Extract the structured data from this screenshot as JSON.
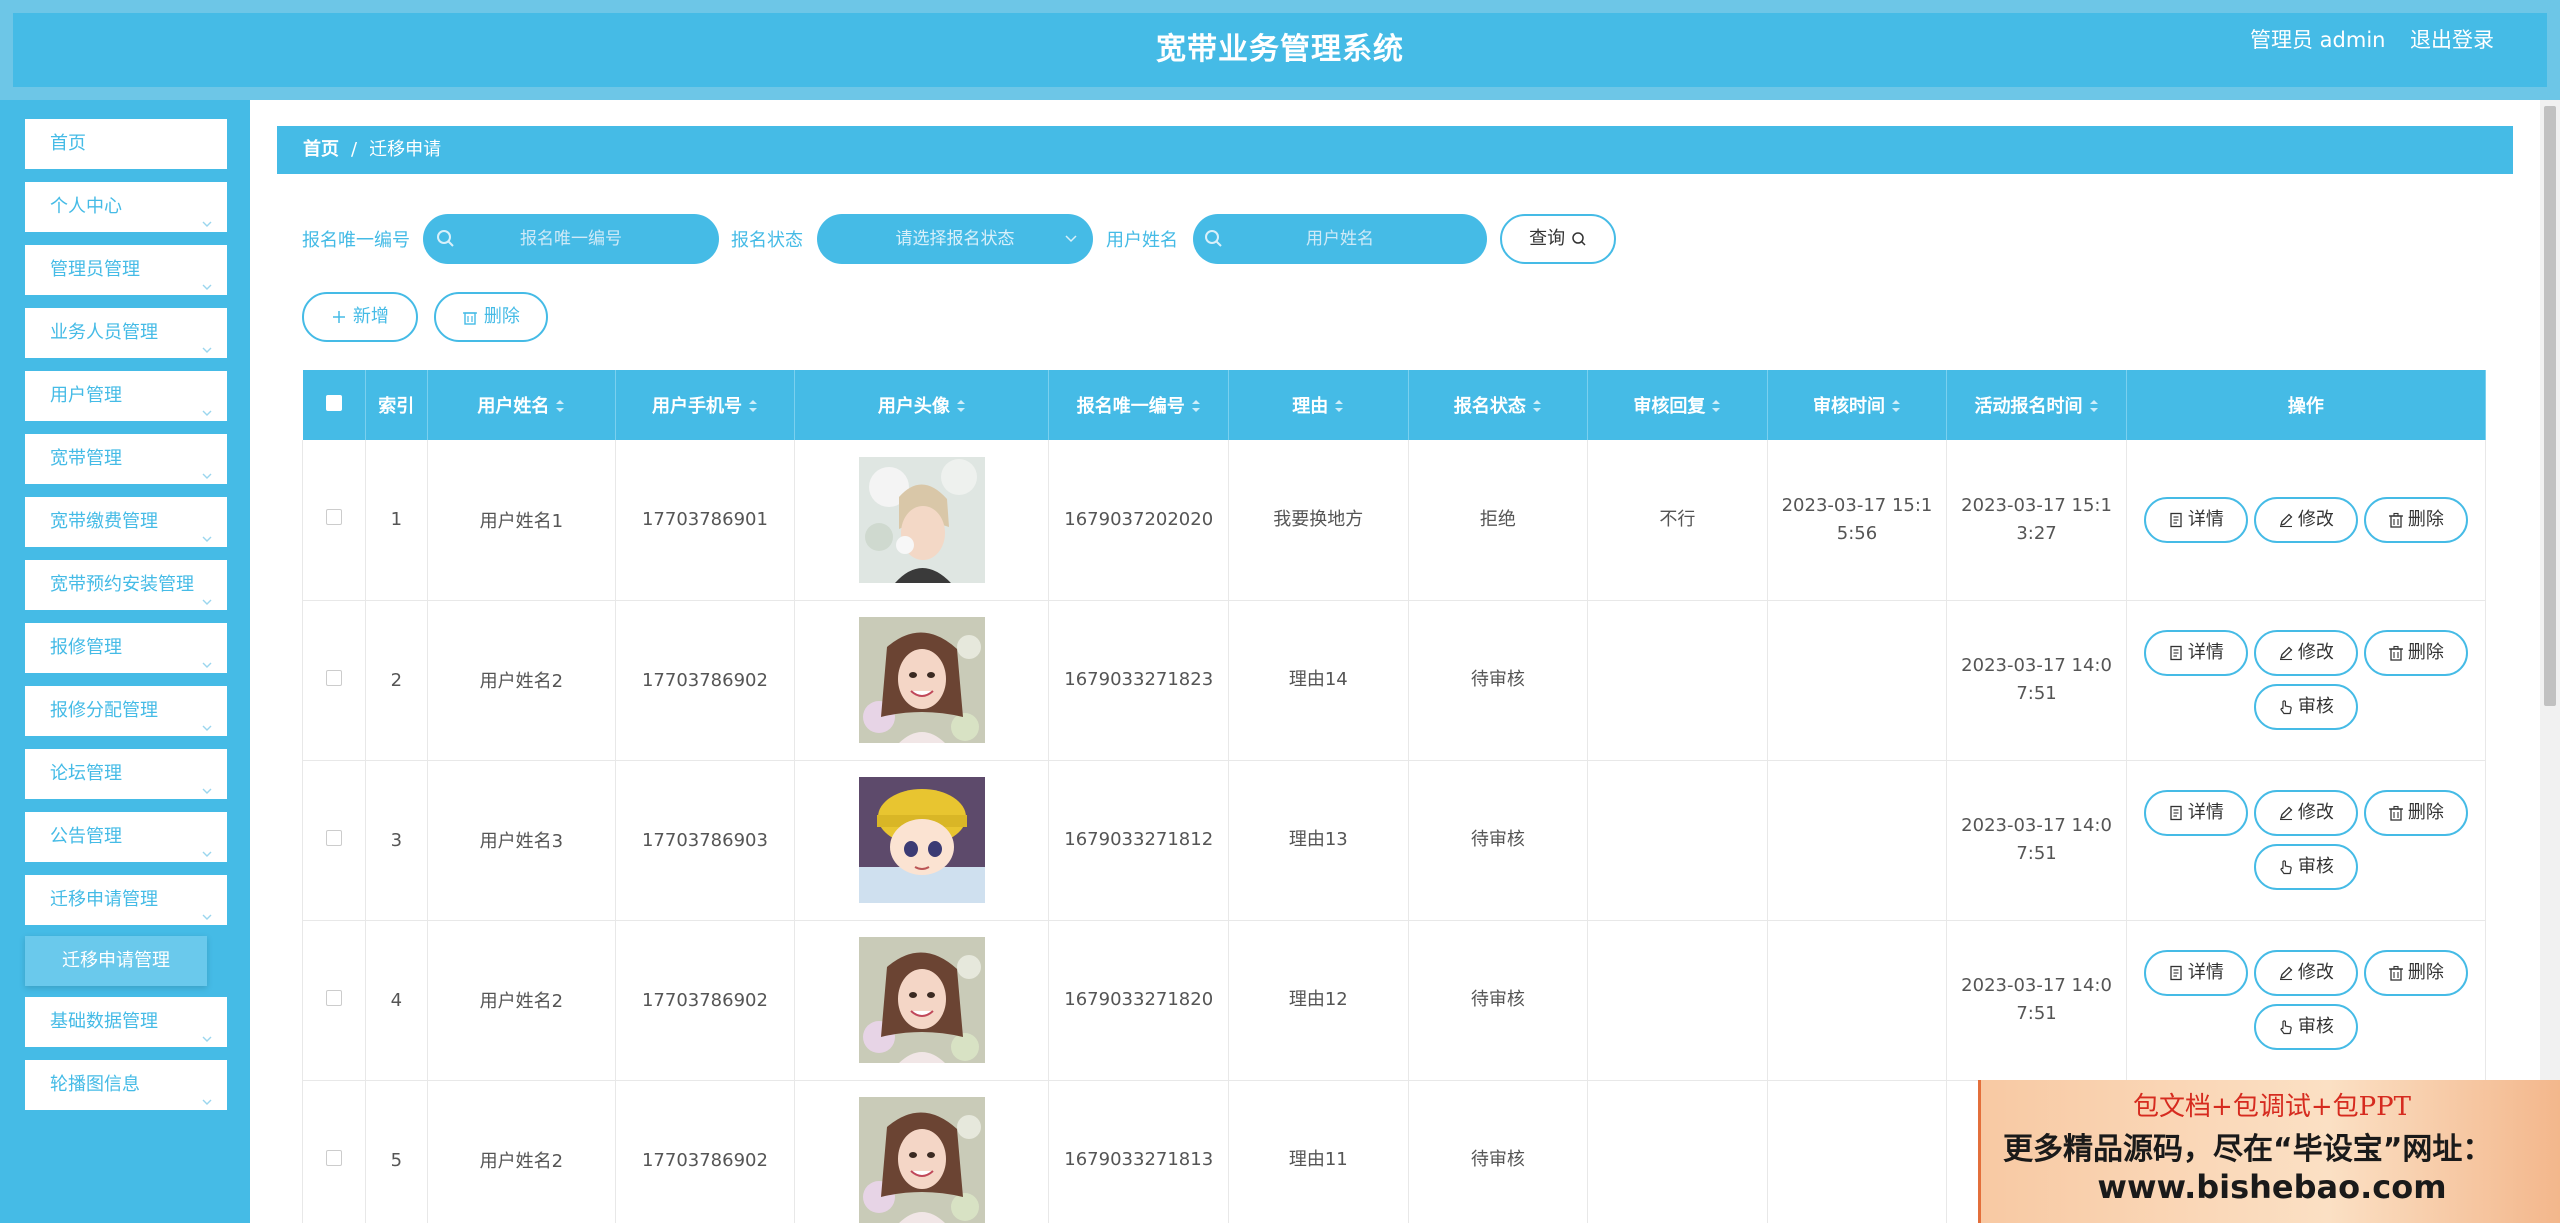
{
  "header": {
    "title": "宽带业务管理系统",
    "admin": "管理员 admin",
    "logout": "退出登录"
  },
  "sidebar": {
    "items": [
      {
        "label": "首页",
        "has_chevron": false
      },
      {
        "label": "个人中心",
        "has_chevron": true
      },
      {
        "label": "管理员管理",
        "has_chevron": true
      },
      {
        "label": "业务人员管理",
        "has_chevron": true
      },
      {
        "label": "用户管理",
        "has_chevron": true
      },
      {
        "label": "宽带管理",
        "has_chevron": true
      },
      {
        "label": "宽带缴费管理",
        "has_chevron": true
      },
      {
        "label": "宽带预约安装管理",
        "has_chevron": true
      },
      {
        "label": "报修管理",
        "has_chevron": true
      },
      {
        "label": "报修分配管理",
        "has_chevron": true
      },
      {
        "label": "论坛管理",
        "has_chevron": true
      },
      {
        "label": "公告管理",
        "has_chevron": true
      },
      {
        "label": "迁移申请管理",
        "has_chevron": true
      },
      {
        "label": "基础数据管理",
        "has_chevron": true
      },
      {
        "label": "轮播图信息",
        "has_chevron": true
      }
    ],
    "active_sub": "迁移申请管理"
  },
  "breadcrumb": {
    "home": "首页",
    "sep": "/",
    "current": "迁移申请"
  },
  "search": {
    "label1": "报名唯一编号",
    "placeholder1": "报名唯一编号",
    "label2": "报名状态",
    "placeholder2": "请选择报名状态",
    "label3": "用户姓名",
    "placeholder3": "用户姓名",
    "query": "查询"
  },
  "actions": {
    "add": "新增",
    "delete": "删除"
  },
  "table": {
    "headers": {
      "index": "索引",
      "name": "用户姓名",
      "phone": "用户手机号",
      "avatar": "用户头像",
      "code": "报名唯一编号",
      "reason": "理由",
      "status": "报名状态",
      "reply": "审核回复",
      "audit_time": "审核时间",
      "apply_time": "活动报名时间",
      "ops": "操作"
    },
    "rows": [
      {
        "index": "1",
        "name": "用户姓名1",
        "phone": "17703786901",
        "avatar": "avatar-man",
        "code": "1679037202020",
        "reason": "我要换地方",
        "status": "拒绝",
        "reply": "不行",
        "audit_time": "2023-03-17 15:15:56",
        "apply_time": "2023-03-17 15:13:27",
        "audit_btn": false
      },
      {
        "index": "2",
        "name": "用户姓名2",
        "phone": "17703786902",
        "avatar": "avatar-woman",
        "code": "1679033271823",
        "reason": "理由14",
        "status": "待审核",
        "reply": "",
        "audit_time": "",
        "apply_time": "2023-03-17 14:07:51",
        "audit_btn": true
      },
      {
        "index": "3",
        "name": "用户姓名3",
        "phone": "17703786903",
        "avatar": "avatar-cartoon",
        "code": "1679033271812",
        "reason": "理由13",
        "status": "待审核",
        "reply": "",
        "audit_time": "",
        "apply_time": "2023-03-17 14:07:51",
        "audit_btn": true
      },
      {
        "index": "4",
        "name": "用户姓名2",
        "phone": "17703786902",
        "avatar": "avatar-woman",
        "code": "1679033271820",
        "reason": "理由12",
        "status": "待审核",
        "reply": "",
        "audit_time": "",
        "apply_time": "2023-03-17 14:07:51",
        "audit_btn": true
      },
      {
        "index": "5",
        "name": "用户姓名2",
        "phone": "17703786902",
        "avatar": "avatar-woman",
        "code": "1679033271813",
        "reason": "理由11",
        "status": "待审核",
        "reply": "",
        "audit_time": "",
        "apply_time": "202",
        "audit_btn": true
      }
    ],
    "op_labels": {
      "detail": "详情",
      "edit": "修改",
      "delete": "删除",
      "audit": "审核"
    }
  },
  "watermark": {
    "line1": "包文档+包调试+包PPT",
    "line2": "更多精品源码，尽在“毕设宝”网址：",
    "line3": "www.bishebao.com"
  },
  "colors": {
    "primary": "#45bbe6",
    "topbar_outer": "#6dc6e7",
    "submenu": "#6ac9ec"
  }
}
